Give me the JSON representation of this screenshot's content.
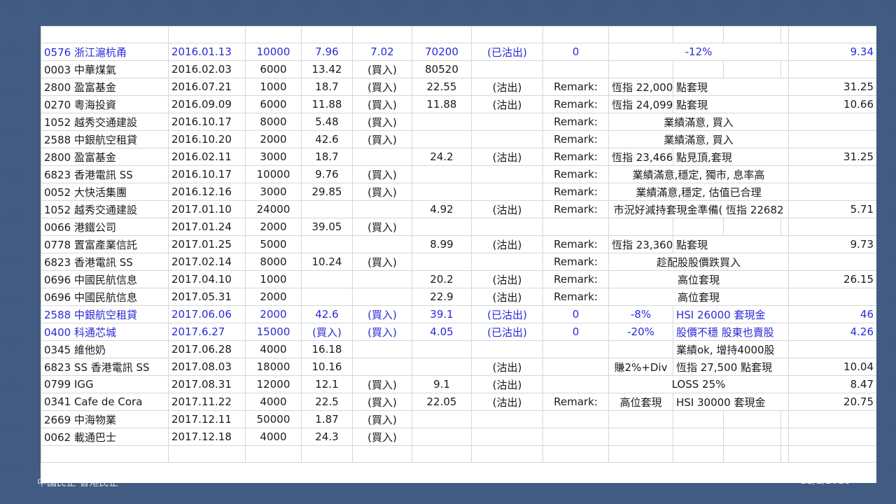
{
  "footer": {
    "left": "中國民企·香港民企",
    "right": "11/1/2018"
  },
  "table": {
    "rows": [
      {
        "style": "blue",
        "cells": [
          "0576 浙江滬杭甬",
          "2016.01.13",
          "10000",
          "7.96",
          "7.02",
          "70200",
          "(已沽出)",
          "0",
          "-12%",
          "",
          "",
          "",
          "9.34"
        ]
      },
      {
        "style": "",
        "cells": [
          "0003 中華煤氣",
          "2016.02.03",
          "6000",
          "13.42",
          "(買入)",
          "80520",
          "",
          "",
          "",
          "",
          "",
          "",
          ""
        ]
      },
      {
        "style": "",
        "cells": [
          "2800 盈富基金",
          "2016.07.21",
          "1000",
          "18.7",
          "(買入)",
          "22.55",
          "(沽出)",
          "Remark:",
          "恆指 22,000",
          "點套現",
          "",
          "",
          "31.25"
        ]
      },
      {
        "style": "",
        "cells": [
          "0270 粵海投資",
          "2016.09.09",
          "6000",
          "11.88",
          "(買入)",
          "11.88",
          "(沽出)",
          "Remark:",
          "恆指 24,099",
          "點套現",
          "",
          "",
          "10.66"
        ]
      },
      {
        "style": "",
        "cells": [
          "1052 越秀交通建設",
          "2016.10.17",
          "8000",
          "5.48",
          "(買入)",
          "",
          "",
          "Remark:",
          "業績滿意, 買入",
          "",
          "",
          "",
          ""
        ]
      },
      {
        "style": "",
        "cells": [
          "2588 中銀航空租貸",
          "2016.10.20",
          "2000",
          "42.6",
          "(買入)",
          "",
          "",
          "Remark:",
          "業績滿意, 買入",
          "",
          "",
          "",
          ""
        ]
      },
      {
        "style": "",
        "cells": [
          "2800 盈富基金",
          "2016.02.11",
          "3000",
          "18.7",
          "",
          "24.2",
          "(沽出)",
          "Remark:",
          "恆指 23,466",
          "點見頂,套現",
          "",
          "",
          "31.25"
        ]
      },
      {
        "style": "",
        "cells": [
          "6823 香港電訊 SS",
          "2016.10.17",
          "10000",
          "9.76",
          "(買入)",
          "",
          "",
          "Remark:",
          "業績滿意,穩定, 獨市, 息率高",
          "",
          "",
          "",
          ""
        ]
      },
      {
        "style": "",
        "cells": [
          "0052 大快活集團",
          "2016.12.16",
          "3000",
          "29.85",
          "(買入)",
          "",
          "",
          "Remark:",
          "業績滿意,穩定, 估值已合理",
          "",
          "",
          "",
          ""
        ]
      },
      {
        "style": "",
        "cells": [
          "1052 越秀交通建設",
          "2017.01.10",
          "24000",
          "",
          "",
          "4.92",
          "(沽出)",
          "Remark:",
          "市況好減持套現金準備( 恆指 22682",
          "",
          "",
          "",
          "5.71"
        ]
      },
      {
        "style": "",
        "cells": [
          "0066 港鐵公司",
          "2017.01.24",
          "2000",
          "39.05",
          "(買入)",
          "",
          "",
          "",
          "",
          "",
          "",
          "",
          ""
        ]
      },
      {
        "style": "",
        "cells": [
          "0778 置富產業信託",
          "2017.01.25",
          "5000",
          "",
          "",
          "8.99",
          "(沽出)",
          "Remark:",
          "恆指 23,360",
          "點套現",
          "",
          "",
          "9.73"
        ]
      },
      {
        "style": "",
        "cells": [
          "6823 香港電訊 SS",
          "2017.02.14",
          "8000",
          "10.24",
          "(買入)",
          "",
          "",
          "Remark:",
          "趁配股股價跌買入",
          "",
          "",
          "",
          ""
        ]
      },
      {
        "style": "",
        "cells": [
          "0696 中國民航信息",
          "2017.04.10",
          "1000",
          "",
          "",
          "20.2",
          "(沽出)",
          "Remark:",
          "高位套現",
          "",
          "",
          "",
          "26.15"
        ]
      },
      {
        "style": "",
        "cells": [
          "0696 中國民航信息",
          "2017.05.31",
          "2000",
          "",
          "",
          "22.9",
          "(沽出)",
          "Remark:",
          "高位套現",
          "",
          "",
          "",
          ""
        ]
      },
      {
        "style": "blue",
        "cells": [
          "2588 中銀航空租貸",
          "2017.06.06",
          "2000",
          "42.6",
          "(買入)",
          "39.1",
          "(已沽出)",
          "0",
          "-8%",
          "HSI 26000 套現金",
          "",
          "",
          "46"
        ]
      },
      {
        "style": "blue",
        "cells": [
          "0400 科通芯城",
          "2017.6.27",
          "15000",
          "(買入)",
          "(買入)",
          "4.05",
          "(已沽出)",
          "0",
          "-20%",
          "股價不穩 股東也賣股",
          "",
          "",
          "4.26"
        ]
      },
      {
        "style": "",
        "cells": [
          "0345 維他奶",
          "2017.06.28",
          "4000",
          "16.18",
          "",
          "",
          "",
          "",
          "",
          "業績ok, 增持4000股",
          "",
          "",
          ""
        ]
      },
      {
        "style": "",
        "cells": [
          "6823 SS 香港電訊 SS",
          "2017.08.03",
          "18000",
          "10.16",
          "",
          "",
          "(沽出)",
          "",
          "賺2%+Div",
          "恆指 27,500 點套現",
          "",
          "",
          "10.04"
        ]
      },
      {
        "style": "",
        "cells": [
          "0799 IGG",
          "2017.08.31",
          "12000",
          "12.1",
          "(買入)",
          "9.1",
          "(沽出)",
          "",
          "LOSS 25%",
          "",
          "",
          "",
          "8.47"
        ]
      },
      {
        "style": "",
        "cells": [
          "0341 Cafe de Cora",
          "2017.11.22",
          "4000",
          "22.5",
          "(買入)",
          "22.05",
          "(沽出)",
          "Remark:",
          "高位套現",
          "HSI 30000 套現金",
          "",
          "",
          "20.75"
        ]
      },
      {
        "style": "",
        "cells": [
          "2669 中海物業",
          "2017.12.11",
          "50000",
          "1.87",
          "(買入)",
          "",
          "",
          "",
          "",
          "",
          "",
          "",
          ""
        ]
      },
      {
        "style": "",
        "cells": [
          "0062 載通巴士",
          "2017.12.18",
          "4000",
          "24.3",
          "(買入)",
          "",
          "",
          "",
          "",
          "",
          "",
          "",
          ""
        ]
      }
    ]
  }
}
